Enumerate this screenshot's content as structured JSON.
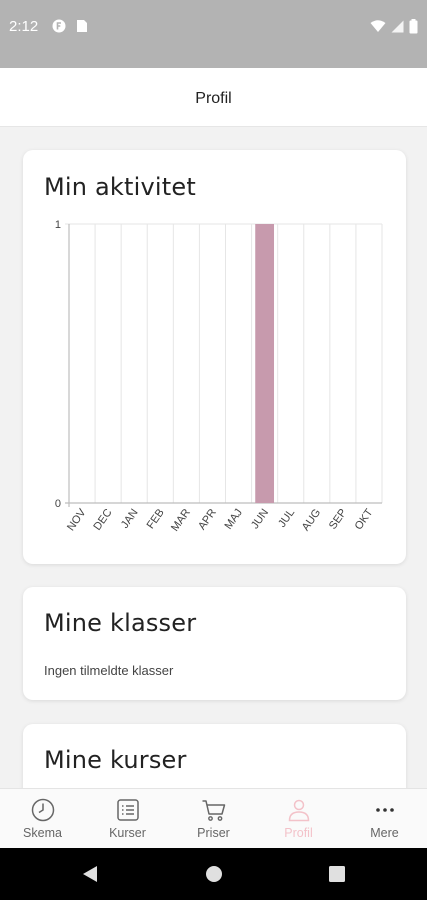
{
  "status_bar": {
    "time": "2:12",
    "icons": [
      "notification-f-icon",
      "sim-card-icon",
      "wifi-icon",
      "signal-icon",
      "battery-icon"
    ]
  },
  "header": {
    "title": "Profil"
  },
  "activity_card": {
    "title": "Min aktivitet"
  },
  "classes_card": {
    "title": "Mine klasser",
    "empty_text": "Ingen tilmeldte klasser"
  },
  "courses_card": {
    "title": "Mine kurser"
  },
  "chart_data": {
    "type": "bar",
    "categories": [
      "NOV",
      "DEC",
      "JAN",
      "FEB",
      "MAR",
      "APR",
      "MAJ",
      "JUN",
      "JUL",
      "AUG",
      "SEP",
      "OKT"
    ],
    "values": [
      0,
      0,
      0,
      0,
      0,
      0,
      0,
      1,
      0,
      0,
      0,
      0
    ],
    "title": "Min aktivitet",
    "xlabel": "",
    "ylabel": "",
    "ylim": [
      0,
      1
    ],
    "yticks": [
      "0",
      "1"
    ],
    "grid": true,
    "bar_color": "#c79aad"
  },
  "bottom_nav": {
    "items": [
      {
        "label": "Skema",
        "icon": "clock-icon",
        "active": false
      },
      {
        "label": "Kurser",
        "icon": "list-icon",
        "active": false
      },
      {
        "label": "Priser",
        "icon": "cart-icon",
        "active": false
      },
      {
        "label": "Profil",
        "icon": "person-icon",
        "active": true
      },
      {
        "label": "Mere",
        "icon": "more-dots-icon",
        "active": false
      }
    ]
  },
  "colors": {
    "accent": "#f3c2c9",
    "bar": "#c79aad",
    "status_bar": "#b3b3b3",
    "nav_inactive": "#666666"
  },
  "system_nav": {
    "icons": [
      "back-icon",
      "home-icon",
      "recents-icon"
    ]
  }
}
